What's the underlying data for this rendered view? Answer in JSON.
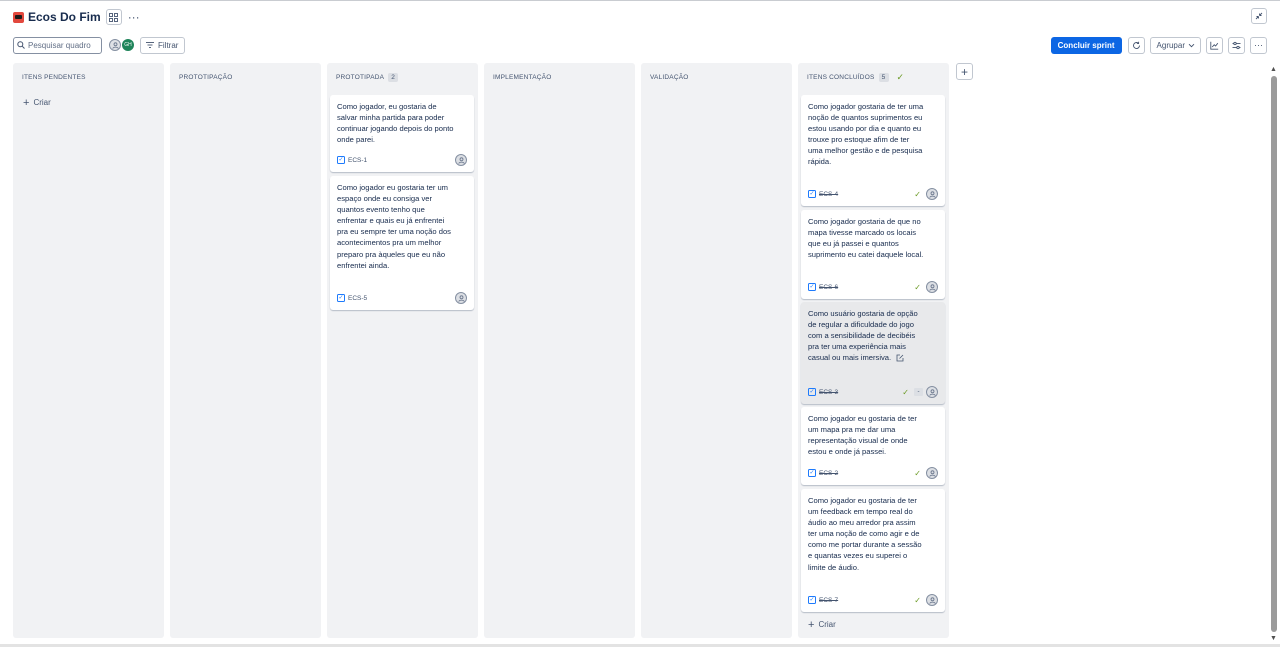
{
  "project": {
    "title": "Ecos Do Fim"
  },
  "toolbar": {
    "search_placeholder": "Pesquisar quadro",
    "avatar_initials": "GH",
    "filter_label": "Filtrar",
    "complete_sprint_label": "Concluir sprint",
    "group_label": "Agrupar"
  },
  "columns": [
    {
      "title": "ITENS PENDENTES",
      "count": "",
      "create_label": "Criar"
    },
    {
      "title": "PROTOTIPAÇÃO",
      "count": ""
    },
    {
      "title": "PROTOTIPADA",
      "count": "2"
    },
    {
      "title": "IMPLEMENTAÇÃO",
      "count": ""
    },
    {
      "title": "VALIDAÇÃO",
      "count": ""
    },
    {
      "title": "ITENS CONCLUÍDOS",
      "count": "5",
      "create_label": "Criar"
    }
  ],
  "cards": {
    "prototipada": [
      {
        "text": "Como jogador, eu gostaria de salvar minha partida para poder continuar jogando depois do ponto onde parei.",
        "key": "ECS-1"
      },
      {
        "text": "Como jogador eu gostaria ter um espaço onde eu consiga ver quantos evento tenho que enfrentar e quais eu já enfrentei pra eu sempre ter uma noção dos acontecimentos pra um melhor preparo pra àqueles que eu não enfrentei ainda.",
        "key": "ECS-5"
      }
    ],
    "concluidos": [
      {
        "text": "Como jogador gostaria de ter uma noção de quantos suprimentos eu estou usando por dia e quanto eu trouxe pro estoque afim de ter uma melhor gestão e de pesquisa rápida.",
        "key": "ECS-4"
      },
      {
        "text": "Como jogador gostaria de que no mapa tivesse marcado os locais que eu já passei e quantos suprimento eu catei daquele local.",
        "key": "ECS-6"
      },
      {
        "text": "Como usuário gostaria de opção de regular a dificuldade do jogo com a sensibilidade de decibéis pra ter uma experiência mais casual ou mais imersiva.",
        "key": "ECS-3",
        "extra": "-"
      },
      {
        "text": "Como jogador eu gostaria de ter um mapa pra me dar uma representação visual de onde estou e onde já passei.",
        "key": "ECS-2"
      },
      {
        "text": "Como jogador eu gostaria de ter um feedback em tempo real do áudio ao meu arredor pra assim ter uma noção de como agir e de como me portar durante a sessão e quantas vezes eu superei o limite de áudio.",
        "key": "ECS-7"
      }
    ]
  }
}
